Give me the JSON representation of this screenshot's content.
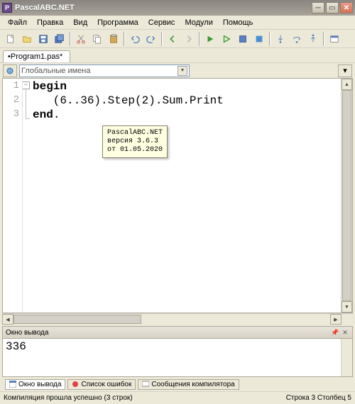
{
  "window": {
    "title": "PascalABC.NET"
  },
  "menu": {
    "items": [
      "Файл",
      "Правка",
      "Вид",
      "Программа",
      "Сервис",
      "Модули",
      "Помощь"
    ]
  },
  "tab": {
    "name": "•Program1.pas*"
  },
  "names_combo": {
    "placeholder": "Глобальные имена"
  },
  "editor": {
    "lines": [
      {
        "n": "1",
        "html": "<span class='kw'>begin</span>"
      },
      {
        "n": "2",
        "html": "   (<span class='num'>6</span>..<span class='num'>36</span>).Step(<span class='num'>2</span>).Sum.Print"
      },
      {
        "n": "3",
        "html": "<span class='kw'>end</span>."
      }
    ]
  },
  "tooltip": {
    "line1": "PascalABC.NET",
    "line2": "версия 3.6.3",
    "line3": "от 01.05.2020"
  },
  "output_panel": {
    "title": "Окно вывода",
    "text": "336"
  },
  "bottom_tabs": {
    "t1": "Окно вывода",
    "t2": "Список ошибок",
    "t3": "Сообщения компилятора"
  },
  "status": {
    "left": "Компиляция прошла успешно (3 строк)",
    "right": "Строка  3 Столбец  5"
  }
}
